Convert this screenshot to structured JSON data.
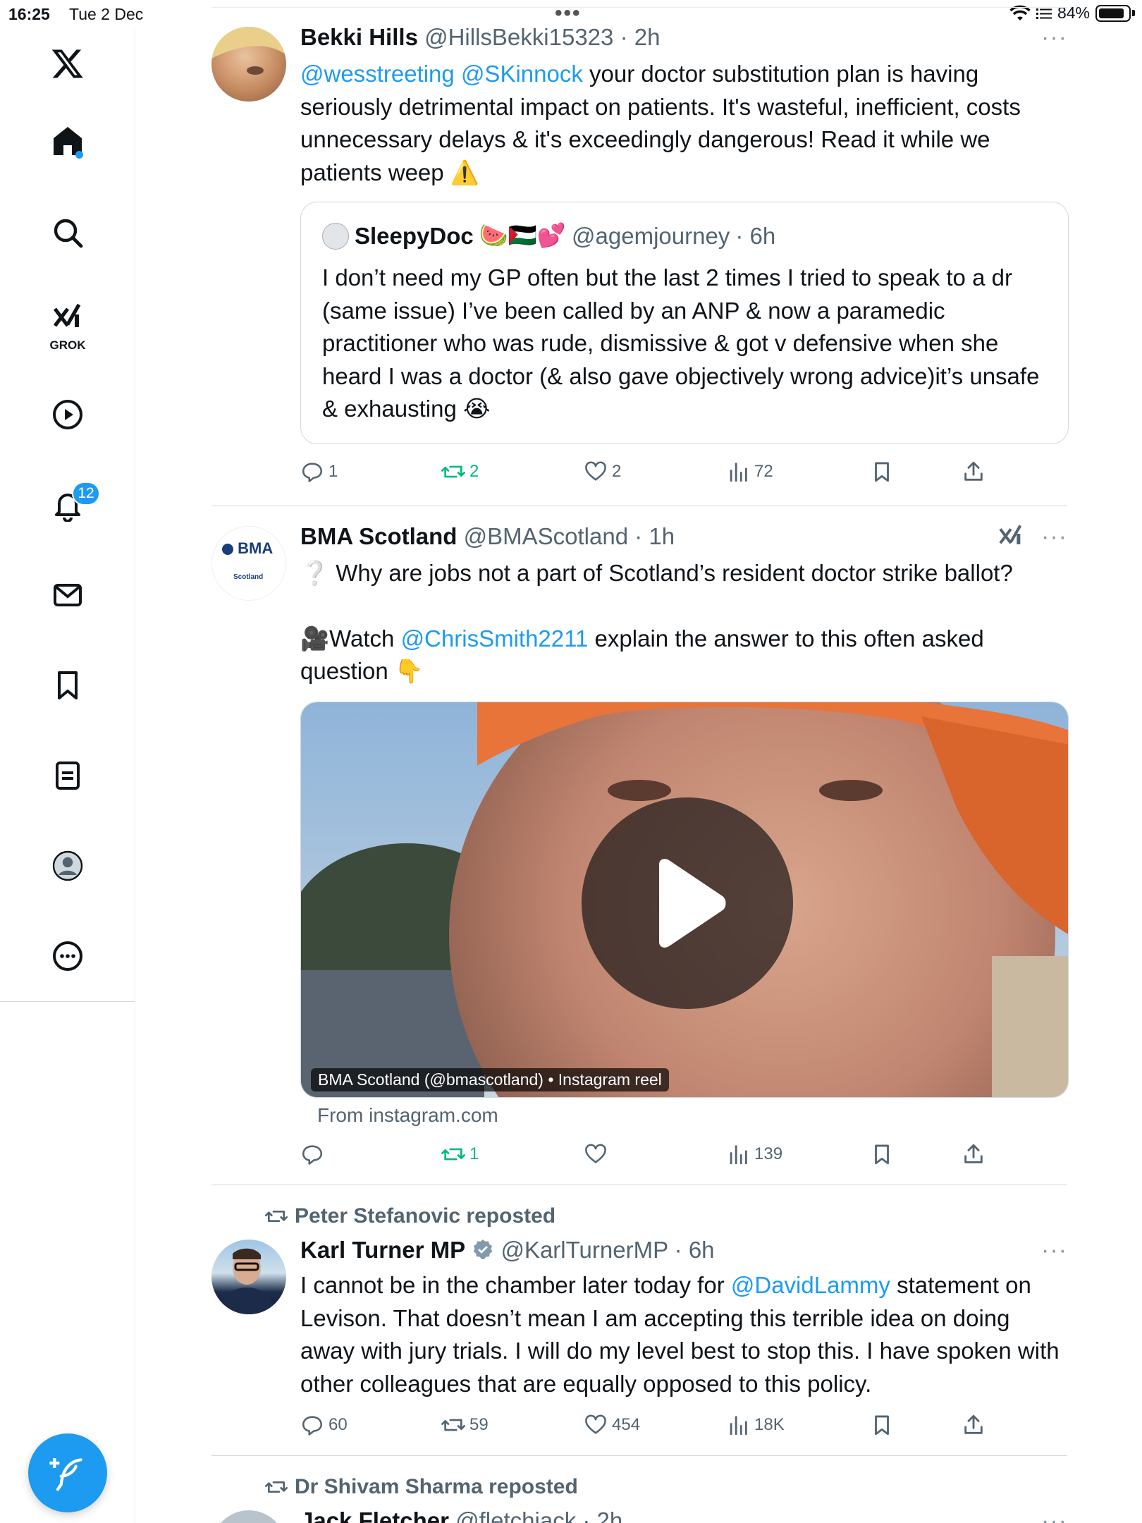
{
  "status_bar": {
    "time": "16:25",
    "date": "Tue 2 Dec",
    "battery": "84%"
  },
  "sidebar": {
    "grok_label": "GROK",
    "notifications_badge": "12"
  },
  "posts": [
    {
      "name": "Bekki Hills",
      "handle": "@HillsBekki15323",
      "time": "· 2h",
      "text_link1": "@wesstreeting",
      "text_link2": "@SKinnock",
      "text_body": " your doctor substitution plan is having seriously detrimental impact on patients. It's wasteful, inefficient, costs unnecessary delays & it's exceedingly dangerous! Read it while we patients weep ⚠️",
      "quote": {
        "name": "SleepyDoc",
        "emojis": "🍉🇵🇸💕",
        "handle": "@agemjourney",
        "time": "· 6h",
        "text": "I don’t need my GP often but the last 2 times I tried to speak to a dr (same issue) I’ve been called by an ANP & now a paramedic practitioner who was rude, dismissive & got v defensive when she heard I was a doctor (& also gave objectively wrong advice)it’s unsafe & exhausting 😭"
      },
      "replies": "1",
      "reposts": "2",
      "likes": "2",
      "views": "72"
    },
    {
      "name": "BMA Scotland",
      "handle": "@BMAScotland",
      "time": "· 1h",
      "avatar_text": "BMA",
      "avatar_sub": "Scotland",
      "line1": "❔ Why are jobs not a part of Scotland’s resident doctor strike ballot?",
      "line2_prefix": "🎥Watch ",
      "line2_link": "@ChrisSmith2211",
      "line2_suffix": "  explain the answer to this often asked question 👇",
      "media_caption": "BMA Scotland (@bmascotland) • Instagram reel",
      "media_source": "From instagram.com",
      "replies": "",
      "reposts": "1",
      "likes": "",
      "views": "139"
    },
    {
      "reposted_by": "Peter Stefanovic reposted",
      "name": "Karl Turner MP",
      "handle": "@KarlTurnerMP",
      "time": "· 6h",
      "text_prefix": "I cannot be in the chamber later today for ",
      "text_link": "@DavidLammy",
      "text_suffix": " statement on Levison. That doesn’t mean I am accepting this terrible idea on doing away with jury trials. I will do my level best to stop this. I have spoken with other colleagues that are equally opposed to this policy.",
      "replies": "60",
      "reposts": "59",
      "likes": "454",
      "views": "18K"
    },
    {
      "reposted_by": "Dr Shivam Sharma reposted",
      "name": "Jack Fletcher",
      "handle": "@fletchjack",
      "time": "· 2h"
    }
  ]
}
